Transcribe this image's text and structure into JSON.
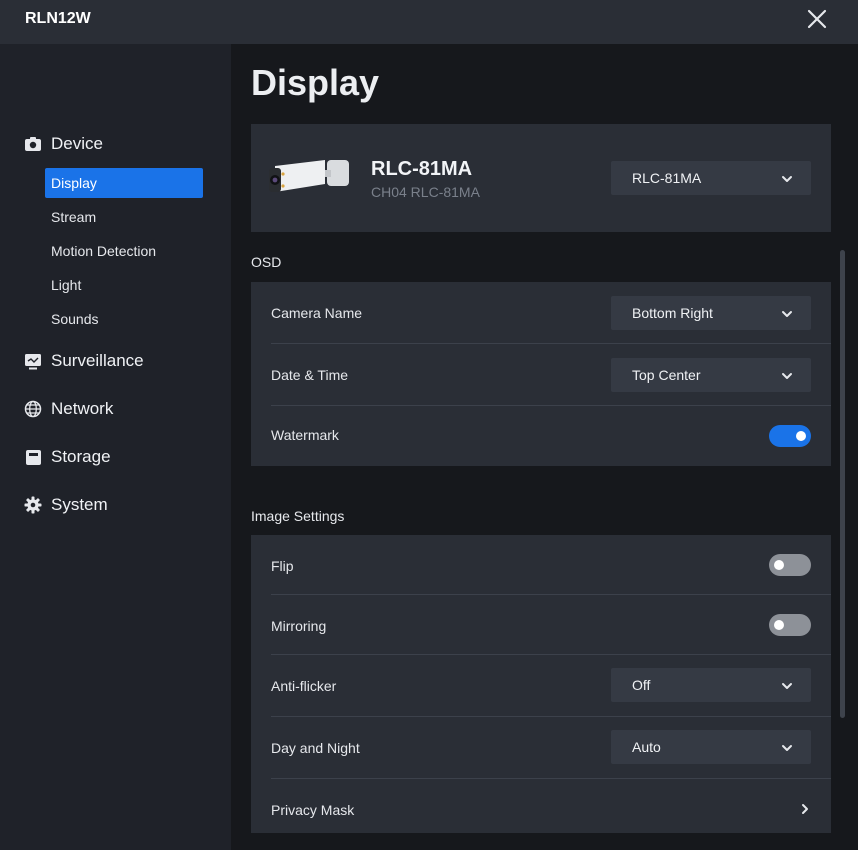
{
  "window": {
    "title": "RLN12W",
    "close_icon": "close-icon"
  },
  "sidebar": {
    "groups": [
      {
        "label": "Device",
        "icon": "camera-icon"
      },
      {
        "label": "Surveillance",
        "icon": "monitor-icon"
      },
      {
        "label": "Network",
        "icon": "globe-icon"
      },
      {
        "label": "Storage",
        "icon": "storage-icon"
      },
      {
        "label": "System",
        "icon": "gear-icon"
      }
    ],
    "device_items": [
      "Display",
      "Stream",
      "Motion Detection",
      "Light",
      "Sounds"
    ],
    "active_item": "Display"
  },
  "page": {
    "title": "Display"
  },
  "camera": {
    "name": "RLC-81MA",
    "subtitle": "CH04 RLC-81MA",
    "selected": "RLC-81MA"
  },
  "osd": {
    "label": "OSD",
    "camera_name": {
      "label": "Camera Name",
      "value": "Bottom Right"
    },
    "date_time": {
      "label": "Date & Time",
      "value": "Top Center"
    },
    "watermark": {
      "label": "Watermark",
      "enabled": true
    }
  },
  "image_settings": {
    "label": "Image Settings",
    "flip": {
      "label": "Flip",
      "enabled": false
    },
    "mirroring": {
      "label": "Mirroring",
      "enabled": false
    },
    "anti_flicker": {
      "label": "Anti-flicker",
      "value": "Off"
    },
    "day_night": {
      "label": "Day and Night",
      "value": "Auto"
    },
    "privacy_mask": {
      "label": "Privacy Mask"
    }
  },
  "colors": {
    "accent": "#1a73e8",
    "panel": "#2a2e36",
    "background": "#16181c",
    "sidebar": "#1f2229"
  }
}
